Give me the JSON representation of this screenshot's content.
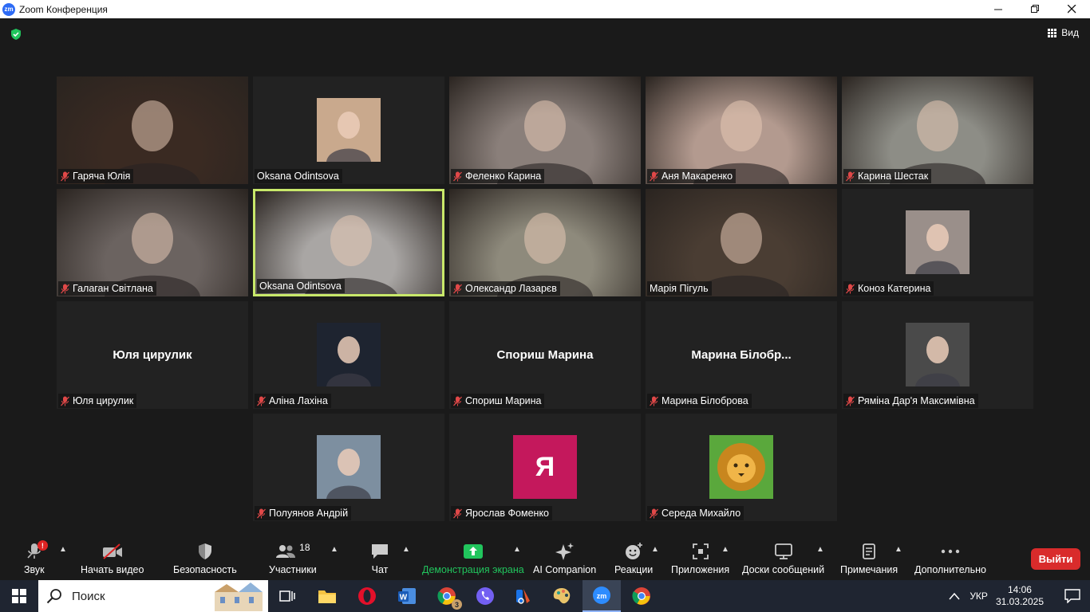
{
  "window": {
    "title": "Zoom Конференция",
    "logo_text": "zm"
  },
  "meeting": {
    "view_label": "Вид"
  },
  "participants": [
    {
      "name": "Гаряча Юлія",
      "muted": true,
      "kind": "video",
      "bg": "#3a2a22"
    },
    {
      "name": "Oksana Odintsova",
      "muted": false,
      "kind": "avatar",
      "bg": "#c9a98d"
    },
    {
      "name": "Феленко Карина",
      "muted": true,
      "kind": "video",
      "bg": "#8a7f7a"
    },
    {
      "name": "Аня Макаренко",
      "muted": true,
      "kind": "video",
      "bg": "#b39a8f"
    },
    {
      "name": "Карина Шестак",
      "muted": true,
      "kind": "video",
      "bg": "#8d8d86"
    },
    {
      "name": "Галаган Світлана",
      "muted": true,
      "kind": "video",
      "bg": "#6b6360"
    },
    {
      "name": "Oksana Odintsova",
      "muted": false,
      "kind": "video",
      "bg": "#a9a6a4",
      "active": true
    },
    {
      "name": "Олександр Лазарєв",
      "muted": true,
      "kind": "video",
      "bg": "#8e8a7c"
    },
    {
      "name": "Марія Пігуль",
      "muted": false,
      "kind": "video",
      "bg": "#4a3d33"
    },
    {
      "name": "Коноз Катерина",
      "muted": true,
      "kind": "avatar",
      "bg": "#9a8f8a"
    },
    {
      "name": "Юля цирулик",
      "muted": true,
      "kind": "name",
      "display": "Юля цирулик"
    },
    {
      "name": "Аліна Лахіна",
      "muted": true,
      "kind": "avatar",
      "bg": "#1e2430"
    },
    {
      "name": "Спориш Марина",
      "muted": true,
      "kind": "name",
      "display": "Спориш Марина"
    },
    {
      "name": "Марина Білоброва",
      "muted": true,
      "kind": "name",
      "display": "Марина Білобр..."
    },
    {
      "name": "Ряміна Дар'я Максимівна",
      "muted": true,
      "kind": "avatar",
      "bg": "#4a4a4a"
    },
    {
      "name": "Полуянов Андрій",
      "muted": true,
      "kind": "avatar",
      "bg": "#7d8fa0"
    },
    {
      "name": "Ярослав Фоменко",
      "muted": true,
      "kind": "letter",
      "letter": "Я",
      "bg": "#c4185c"
    },
    {
      "name": "Середа Михайло",
      "muted": true,
      "kind": "lion",
      "bg": "#5aa83c"
    }
  ],
  "toolbar": {
    "audio_label": "Звук",
    "audio_badge": "!",
    "video_label": "Начать видео",
    "security_label": "Безопасность",
    "participants_label": "Участники",
    "participants_count": "18",
    "chat_label": "Чат",
    "share_label": "Демонстрация экрана",
    "ai_label": "AI Companion",
    "reactions_label": "Реакции",
    "apps_label": "Приложения",
    "whiteboards_label": "Доски сообщений",
    "notes_label": "Примечания",
    "more_label": "Дополнительно",
    "leave_label": "Выйти"
  },
  "taskbar": {
    "search_label": "Поиск",
    "chrome_badge": "3",
    "lang": "УКР",
    "time": "14:06",
    "date": "31.03.2025"
  },
  "colors": {
    "accent_green": "#21c55d",
    "leave_red": "#d92b2b",
    "active_speaker": "#c8e86a"
  }
}
